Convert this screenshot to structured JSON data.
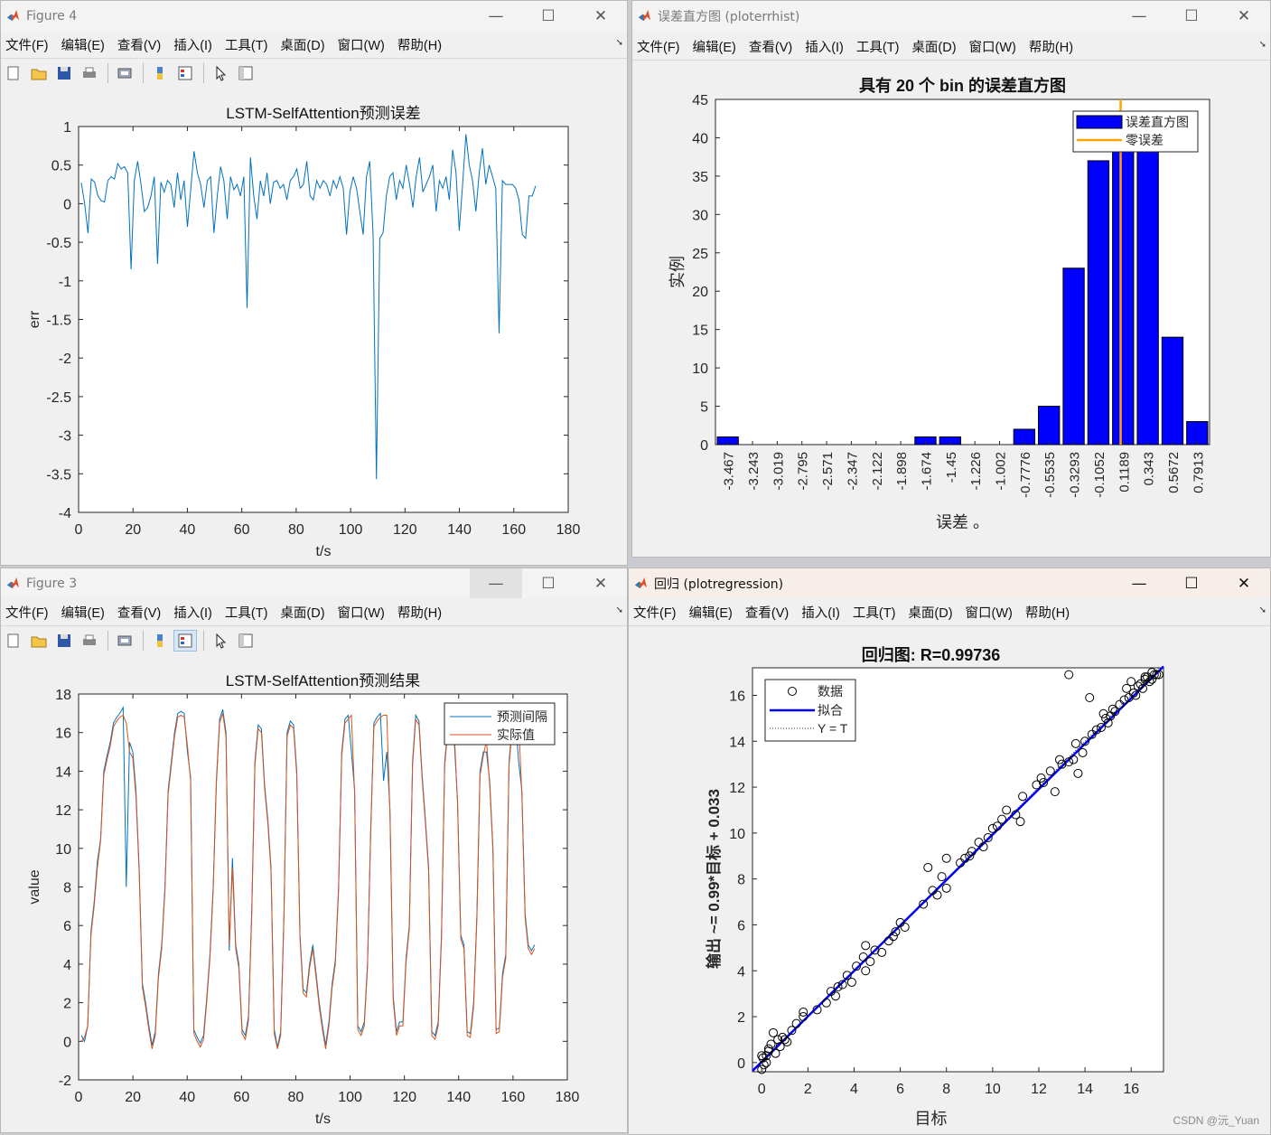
{
  "menu": [
    "文件(F)",
    "编辑(E)",
    "查看(V)",
    "插入(I)",
    "工具(T)",
    "桌面(D)",
    "窗口(W)",
    "帮助(H)"
  ],
  "window_controls": {
    "minimize": "—",
    "maximize": "☐",
    "close": "✕"
  },
  "fig4": {
    "title": "Figure 4",
    "chart_data": {
      "type": "line",
      "title": "LSTM-SelfAttention预测误差",
      "xlabel": "t/s",
      "ylabel": "err",
      "xlim": [
        0,
        180
      ],
      "ylim": [
        -4,
        1
      ],
      "xticks": [
        "0",
        "20",
        "40",
        "60",
        "80",
        "100",
        "120",
        "140",
        "160",
        "180"
      ],
      "yticks": [
        "1",
        "0.5",
        "0",
        "-0.5",
        "-1",
        "-1.5",
        "-2",
        "-2.5",
        "-3",
        "-3.5",
        "-4"
      ],
      "series": [
        {
          "color": "#0072BD",
          "y": [
            0.27,
            0.0,
            -0.38,
            0.32,
            0.28,
            0.1,
            0.04,
            0.02,
            0.3,
            0.35,
            0.32,
            0.52,
            0.45,
            0.48,
            0.4,
            -0.85,
            0.3,
            0.55,
            0.25,
            -0.1,
            -0.05,
            0.1,
            0.35,
            -0.78,
            0.28,
            0.15,
            0.3,
            0.25,
            -0.05,
            0.4,
            0.05,
            0.3,
            -0.3,
            0.18,
            0.68,
            0.4,
            0.25,
            -0.05,
            0.3,
            0.35,
            -0.38,
            0.1,
            0.48,
            0.3,
            -0.2,
            0.35,
            0.18,
            0.25,
            0.1,
            0.35,
            -1.35,
            0.6,
            0.1,
            -0.2,
            0.3,
            0.1,
            0.4,
            0.0,
            0.28,
            0.3,
            0.2,
            0.25,
            0.05,
            0.3,
            0.35,
            0.45,
            0.2,
            0.25,
            0.55,
            0.1,
            0.05,
            0.3,
            0.2,
            0.3,
            0.25,
            0.1,
            0.3,
            0.2,
            0.35,
            0.2,
            -0.4,
            0.15,
            0.35,
            0.2,
            -0.1,
            -0.4,
            0.35,
            0.55,
            -0.4,
            -3.57,
            -0.45,
            -0.38,
            0.1,
            0.35,
            0.4,
            0.05,
            0.3,
            0.2,
            0.5,
            0.25,
            -0.05,
            0.35,
            0.6,
            0.15,
            0.25,
            0.35,
            0.5,
            -0.1,
            0.3,
            0.2,
            0.35,
            0.05,
            0.7,
            0.4,
            -0.35,
            0.25,
            0.9,
            0.5,
            0.3,
            -0.1,
            0.4,
            0.72,
            0.25,
            0.5,
            0.35,
            0.2,
            -1.68,
            0.3,
            0.25,
            0.25,
            0.25,
            0.2,
            0.05,
            -0.4,
            -0.45,
            0.1,
            0.1,
            0.23
          ]
        }
      ]
    }
  },
  "fig_hist": {
    "title": "误差直方图 (ploterrhist)",
    "chart_data": {
      "type": "bar",
      "title": "具有 20 个 bin 的误差直方图",
      "xlabel": "误差 。",
      "ylabel": "实例",
      "ylim": [
        0,
        45
      ],
      "yticks": [
        "45",
        "40",
        "35",
        "30",
        "25",
        "20",
        "15",
        "10",
        "5",
        "0"
      ],
      "categories": [
        "-3.467",
        "-3.243",
        "-3.019",
        "-2.795",
        "-2.571",
        "-2.347",
        "-2.122",
        "-1.898",
        "-1.674",
        "-1.45",
        "-1.226",
        "-1.002",
        "-0.7776",
        "-0.5535",
        "-0.3293",
        "-0.1052",
        "0.1189",
        "0.343",
        "0.5672",
        "0.7913"
      ],
      "values": [
        1,
        0,
        0,
        0,
        0,
        0,
        0,
        0,
        1,
        1,
        0,
        0,
        2,
        5,
        23,
        37,
        41,
        41,
        14,
        3
      ],
      "zero_error_x": 16.4,
      "legend": [
        "误差直方图",
        "零误差"
      ],
      "colors": {
        "bar": "#0000ff",
        "zero": "#ffa500"
      }
    }
  },
  "fig3": {
    "title": "Figure 3",
    "chart_data": {
      "type": "line",
      "title": "LSTM-SelfAttention预测结果",
      "xlabel": "t/s",
      "ylabel": "value",
      "xlim": [
        0,
        180
      ],
      "ylim": [
        -2,
        18
      ],
      "xticks": [
        "0",
        "20",
        "40",
        "60",
        "80",
        "100",
        "120",
        "140",
        "160",
        "180"
      ],
      "yticks": [
        "18",
        "16",
        "14",
        "12",
        "10",
        "8",
        "6",
        "4",
        "2",
        "0",
        "-2"
      ],
      "legend": [
        "预测间隔",
        "实际值"
      ],
      "series": [
        {
          "name": "预测间隔",
          "color": "#0072BD",
          "y": [
            0.3,
            0.0,
            0.8,
            5.7,
            7.2,
            9.3,
            10.5,
            14.0,
            14.8,
            15.5,
            16.5,
            16.8,
            17.0,
            17.3,
            8.0,
            15.5,
            15.0,
            13.0,
            8.9,
            3.0,
            2.0,
            0.8,
            -0.2,
            0.5,
            3.5,
            5.0,
            8.0,
            13.0,
            14.5,
            16.0,
            17.0,
            17.1,
            17.0,
            15.0,
            13.7,
            0.6,
            0.2,
            -0.1,
            0.3,
            2.2,
            4.5,
            8.0,
            13.5,
            16.7,
            17.2,
            16.0,
            4.7,
            9.5,
            5.0,
            4.0,
            0.6,
            0.3,
            1.3,
            6.8,
            14.5,
            16.4,
            16.2,
            13.3,
            11.5,
            9.0,
            0.6,
            -0.3,
            0.5,
            6.5,
            16.0,
            16.6,
            16.4,
            14.0,
            5.5,
            2.7,
            2.5,
            4.0,
            5.0,
            3.5,
            2.0,
            0.8,
            -0.2,
            1.0,
            3.0,
            4.2,
            8.0,
            15.0,
            16.7,
            16.9,
            15.0,
            13.0,
            0.8,
            0.5,
            1.0,
            4.0,
            11.0,
            16.5,
            16.8,
            17.0,
            13.5,
            15.0,
            12.0,
            2.3,
            0.5,
            1.0,
            1.0,
            4.3,
            6.0,
            14.5,
            16.9,
            16.6,
            13.8,
            11.5,
            9.0,
            0.5,
            0.3,
            1.0,
            5.5,
            14.5,
            16.3,
            16.6,
            15.5,
            12.5,
            5.5,
            5.0,
            0.5,
            0.4,
            2.0,
            6.5,
            14.0,
            15.0,
            15.0,
            13.5,
            10.0,
            0.6,
            0.7,
            3.5,
            4.5,
            14.5,
            16.3,
            16.7,
            14.5,
            13.0,
            6.6,
            5.0,
            4.7,
            5.0
          ]
        },
        {
          "name": "实际值",
          "color": "#D95319",
          "y": [
            0.0,
            0.2,
            0.8,
            5.5,
            7.0,
            9.0,
            10.4,
            13.8,
            14.6,
            15.3,
            16.3,
            16.6,
            16.8,
            16.9,
            16.5,
            15.0,
            14.7,
            12.7,
            8.7,
            2.8,
            1.8,
            0.6,
            -0.4,
            0.3,
            3.3,
            4.8,
            7.8,
            12.8,
            14.3,
            15.8,
            16.8,
            16.9,
            16.8,
            15.3,
            13.5,
            0.4,
            0.0,
            -0.3,
            0.1,
            2.0,
            4.3,
            7.8,
            13.3,
            16.5,
            17.0,
            15.8,
            5.0,
            9.0,
            4.8,
            3.8,
            0.4,
            0.1,
            1.1,
            6.6,
            14.3,
            16.2,
            16.0,
            13.1,
            11.3,
            8.8,
            0.4,
            -0.4,
            0.3,
            6.3,
            15.8,
            16.4,
            16.2,
            13.8,
            5.3,
            2.5,
            2.3,
            3.8,
            4.8,
            3.3,
            1.8,
            0.6,
            -0.4,
            0.8,
            2.8,
            4.0,
            7.8,
            14.8,
            16.5,
            16.7,
            16.9,
            12.8,
            0.6,
            0.3,
            0.8,
            3.8,
            10.8,
            16.3,
            16.6,
            16.8,
            16.9,
            16.9,
            11.8,
            2.1,
            0.3,
            0.8,
            0.8,
            4.1,
            5.8,
            14.3,
            16.7,
            16.4,
            13.6,
            11.3,
            8.8,
            0.3,
            0.1,
            0.8,
            5.3,
            14.3,
            16.1,
            16.4,
            16.0,
            12.3,
            5.3,
            4.8,
            0.3,
            0.2,
            1.8,
            6.3,
            13.8,
            14.8,
            15.6,
            13.3,
            9.8,
            0.4,
            0.5,
            3.3,
            4.3,
            14.3,
            16.1,
            16.5,
            16.6,
            12.8,
            6.4,
            4.8,
            4.5,
            4.8
          ]
        }
      ]
    }
  },
  "fig_reg": {
    "title": "回归 (plotregression)",
    "chart_data": {
      "type": "scatter",
      "title": "回归图: R=0.99736",
      "xlabel": "目标",
      "ylabel": "输出 ~= 0.99*目标 + 0.033",
      "xlim": [
        -0.4,
        17.4
      ],
      "ylim": [
        -0.4,
        17.2
      ],
      "xticks": [
        "0",
        "2",
        "4",
        "6",
        "8",
        "10",
        "12",
        "14",
        "16"
      ],
      "yticks": [
        "16",
        "14",
        "12",
        "10",
        "8",
        "6",
        "4",
        "2",
        "0"
      ],
      "legend": [
        "数据",
        "拟合",
        "Y = T"
      ],
      "fit": {
        "slope": 0.99,
        "intercept": 0.033
      },
      "points": [
        [
          0,
          -0.3
        ],
        [
          0.05,
          0.2
        ],
        [
          0.1,
          -0.1
        ],
        [
          0.2,
          0.3
        ],
        [
          0.3,
          0.5
        ],
        [
          0.4,
          0.8
        ],
        [
          0.5,
          1.3
        ],
        [
          0.6,
          0.4
        ],
        [
          0.7,
          1.0
        ],
        [
          0.8,
          0.7
        ],
        [
          0.9,
          1.1
        ],
        [
          1.0,
          1.0
        ],
        [
          1.3,
          1.4
        ],
        [
          1.5,
          1.7
        ],
        [
          1.8,
          2.2
        ],
        [
          1.8,
          2.0
        ],
        [
          2.8,
          2.6
        ],
        [
          3.0,
          3.1
        ],
        [
          3.2,
          2.9
        ],
        [
          3.3,
          3.3
        ],
        [
          3.7,
          3.8
        ],
        [
          3.9,
          3.5
        ],
        [
          4.1,
          4.2
        ],
        [
          4.5,
          5.1
        ],
        [
          4.5,
          4.0
        ],
        [
          4.7,
          4.4
        ],
        [
          4.9,
          4.9
        ],
        [
          5.2,
          4.8
        ],
        [
          5.5,
          5.3
        ],
        [
          5.7,
          5.5
        ],
        [
          6.2,
          5.9
        ],
        [
          7.0,
          6.9
        ],
        [
          7.2,
          8.5
        ],
        [
          7.4,
          7.5
        ],
        [
          7.6,
          7.3
        ],
        [
          7.8,
          8.1
        ],
        [
          8.0,
          8.9
        ],
        [
          8.0,
          7.6
        ],
        [
          8.6,
          8.7
        ],
        [
          8.8,
          8.9
        ],
        [
          9.1,
          9.2
        ],
        [
          9.4,
          9.6
        ],
        [
          9.6,
          9.4
        ],
        [
          9.8,
          9.8
        ],
        [
          10.0,
          10.2
        ],
        [
          10.2,
          10.3
        ],
        [
          10.6,
          11.0
        ],
        [
          11.0,
          10.8
        ],
        [
          11.2,
          10.5
        ],
        [
          11.3,
          11.6
        ],
        [
          11.9,
          12.1
        ],
        [
          12.2,
          12.2
        ],
        [
          12.5,
          12.7
        ],
        [
          12.7,
          11.8
        ],
        [
          12.9,
          13.2
        ],
        [
          13.3,
          13.1
        ],
        [
          13.3,
          16.9
        ],
        [
          13.5,
          13.2
        ],
        [
          13.7,
          12.6
        ],
        [
          13.9,
          13.5
        ],
        [
          14.0,
          14.0
        ],
        [
          14.2,
          15.9
        ],
        [
          14.3,
          14.3
        ],
        [
          14.5,
          14.5
        ],
        [
          14.7,
          14.6
        ],
        [
          14.9,
          15.0
        ],
        [
          15.1,
          15.1
        ],
        [
          15.3,
          15.3
        ],
        [
          15.5,
          15.6
        ],
        [
          15.7,
          15.8
        ],
        [
          15.9,
          15.9
        ],
        [
          16.1,
          16.1
        ],
        [
          16.3,
          16.4
        ],
        [
          16.4,
          16.5
        ],
        [
          16.5,
          16.3
        ],
        [
          16.6,
          16.7
        ],
        [
          16.7,
          16.8
        ],
        [
          16.8,
          16.6
        ],
        [
          16.9,
          17.0
        ],
        [
          17.0,
          16.9
        ],
        [
          17.1,
          16.9
        ],
        [
          15.8,
          16.3
        ],
        [
          16.0,
          16.6
        ],
        [
          16.2,
          16.0
        ],
        [
          14.8,
          15.2
        ],
        [
          15.0,
          14.8
        ],
        [
          13.6,
          13.9
        ],
        [
          12.1,
          12.4
        ],
        [
          10.4,
          10.6
        ],
        [
          9.0,
          9.0
        ],
        [
          6.0,
          6.1
        ],
        [
          5.8,
          5.7
        ],
        [
          4.4,
          4.6
        ],
        [
          3.5,
          3.4
        ],
        [
          2.4,
          2.3
        ],
        [
          0.2,
          0.0
        ],
        [
          0.3,
          0.6
        ],
        [
          0.0,
          0.3
        ],
        [
          1.1,
          0.9
        ],
        [
          16.6,
          16.8
        ],
        [
          16.9,
          16.7
        ],
        [
          17.2,
          16.9
        ],
        [
          15.2,
          15.4
        ],
        [
          13.0,
          13.0
        ]
      ]
    },
    "watermark": "CSDN @沅_Yuan"
  }
}
